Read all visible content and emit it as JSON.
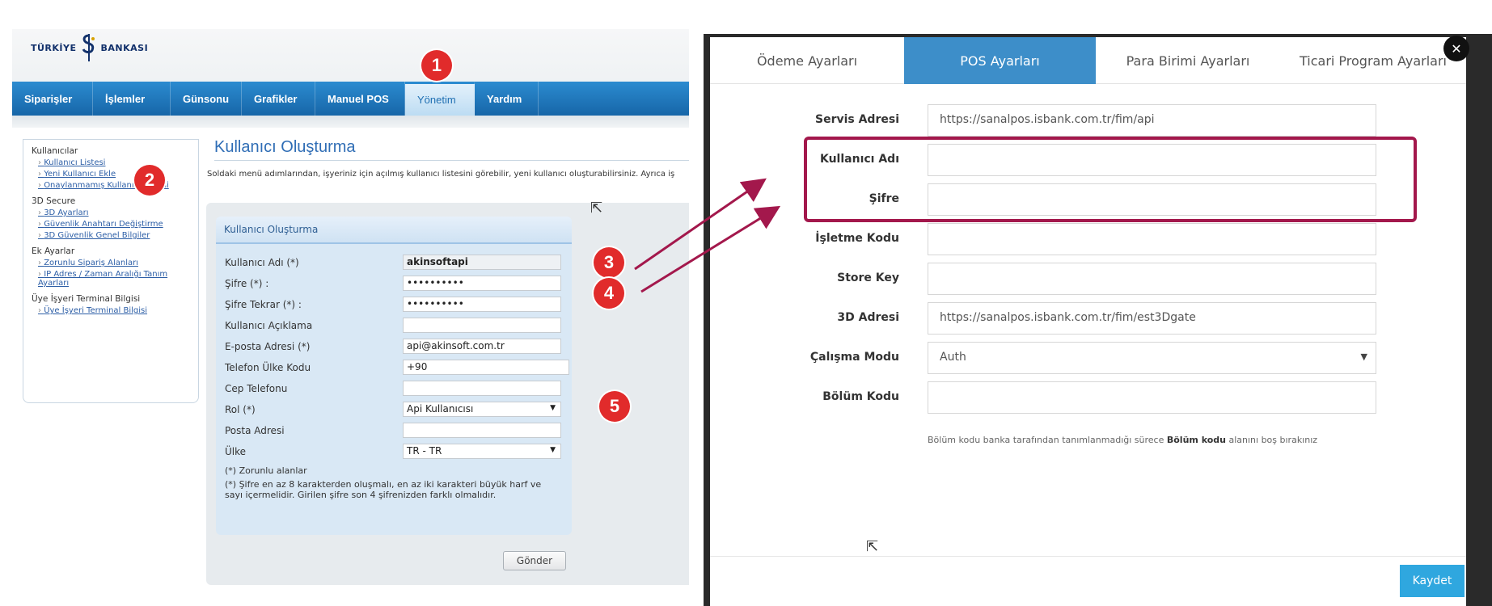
{
  "bank": {
    "logo_left": "TÜRKİYE",
    "logo_right": "BANKASI",
    "nav": [
      "Siparişler",
      "İşlemler",
      "Günsonu",
      "Grafikler",
      "Manuel POS",
      "Yönetim",
      "Yardım"
    ],
    "nav_active": "Yönetim",
    "sidebar": {
      "groups": [
        {
          "title": "Kullanıcılar",
          "links": [
            "Kullanıcı Listesi",
            "Yeni Kullanıcı Ekle",
            "Onaylanmamış Kullanıcı Listesi"
          ]
        },
        {
          "title": "3D Secure",
          "links": [
            "3D Ayarları",
            "Güvenlik Anahtarı Değiştirme",
            "3D Güvenlik Genel Bilgiler"
          ]
        },
        {
          "title": "Ek Ayarlar",
          "links": [
            "Zorunlu Sipariş Alanları",
            "IP Adres / Zaman Aralığı Tanım Ayarları"
          ]
        },
        {
          "title": "Üye İşyeri Terminal Bilgisi",
          "links": [
            "Üye İşyeri Terminal Bilgisi"
          ]
        }
      ]
    },
    "page_title": "Kullanıcı Oluşturma",
    "intro": "Soldaki menü adımlarından, işyeriniz için açılmış kullanıcı listesini görebilir, yeni kullanıcı oluşturabilirsiniz. Ayrıca iş",
    "form_title": "Kullanıcı Oluşturma",
    "fields": [
      {
        "label": "Kullanıcı Adı (*)",
        "value": "akinsoftapi"
      },
      {
        "label": "Şifre (*) :",
        "value": "••••••••••"
      },
      {
        "label": "Şifre Tekrar (*) :",
        "value": "••••••••••"
      },
      {
        "label": "Kullanıcı Açıklama",
        "value": ""
      },
      {
        "label": "E-posta Adresi (*)",
        "value": "api@akinsoft.com.tr"
      },
      {
        "label": "Telefon Ülke Kodu",
        "value": "+90"
      },
      {
        "label": "Cep Telefonu",
        "value": ""
      },
      {
        "label": "Rol (*)",
        "value": "Api Kullanıcısı"
      },
      {
        "label": "Posta Adresi",
        "value": ""
      },
      {
        "label": "Ülke",
        "value": "TR - TR"
      }
    ],
    "note1": "(*) Zorunlu alanlar",
    "note2a": "(*) Şifre en az 8 karakterden oluşmalı, en az iki karakteri büyük harf ve",
    "note2b": "sayı içermelidir. Girilen şifre son 4 şifrenizden farklı olmalıdır.",
    "submit": "Gönder"
  },
  "badges": [
    "1",
    "2",
    "3",
    "4",
    "5"
  ],
  "modal": {
    "tabs": [
      "Ödeme Ayarları",
      "POS Ayarları",
      "Para Birimi Ayarları",
      "Ticari Program Ayarları"
    ],
    "active_tab": "POS Ayarları",
    "fields": [
      {
        "label": "Servis Adresi",
        "value": "https://sanalpos.isbank.com.tr/fim/api"
      },
      {
        "label": "Kullanıcı Adı",
        "value": ""
      },
      {
        "label": "Şifre",
        "value": ""
      },
      {
        "label": "İşletme Kodu",
        "value": ""
      },
      {
        "label": "Store Key",
        "value": ""
      },
      {
        "label": "3D Adresi",
        "value": "https://sanalpos.isbank.com.tr/fim/est3Dgate"
      },
      {
        "label": "Çalışma Modu",
        "value": "Auth"
      },
      {
        "label": "Bölüm Kodu",
        "value": ""
      }
    ],
    "hint_pre": "Bölüm kodu banka tarafından tanımlanmadığı sürece",
    "hint_bold": "Bölüm kodu",
    "hint_post": "alanını boş bırakınız",
    "save": "Kaydet",
    "close": "✕"
  },
  "colors": {
    "bank_nav": "#1f7bc0",
    "modal_tab_active": "#3d8ec9",
    "highlight": "#a3184c",
    "badge": "#e12b2b",
    "save": "#2fa7df"
  }
}
